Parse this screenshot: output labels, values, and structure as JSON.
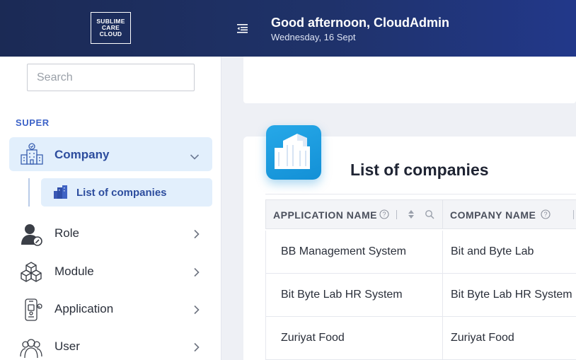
{
  "header": {
    "logo_lines": [
      "SUBLIME",
      "CARE",
      "CLOUD"
    ],
    "greeting": "Good afternoon, CloudAdmin",
    "date": "Wednesday, 16 Sept"
  },
  "sidebar": {
    "search_placeholder": "Search",
    "section_label": "SUPER",
    "active_item": {
      "label": "Company",
      "icon": "company-icon"
    },
    "sub_item": {
      "label": "List of companies",
      "icon": "buildings-icon"
    },
    "items": [
      {
        "label": "Role",
        "icon": "role-icon"
      },
      {
        "label": "Module",
        "icon": "module-icon"
      },
      {
        "label": "Application",
        "icon": "application-icon"
      },
      {
        "label": "User",
        "icon": "user-icon"
      }
    ]
  },
  "main": {
    "title": "List of companies",
    "table": {
      "columns": [
        "APPLICATION NAME",
        "COMPANY NAME"
      ],
      "rows": [
        [
          "BB Management System",
          "Bit and Byte Lab"
        ],
        [
          "Bit Byte Lab HR System",
          "Bit Byte Lab HR System"
        ],
        [
          "Zuriyat Food",
          "Zuriyat Food"
        ]
      ]
    }
  },
  "colors": {
    "header_start": "#1b2a55",
    "header_end": "#22388a",
    "accent": "#3d63c8",
    "active_bg": "#e2effc",
    "badge": "#1e9de0"
  }
}
